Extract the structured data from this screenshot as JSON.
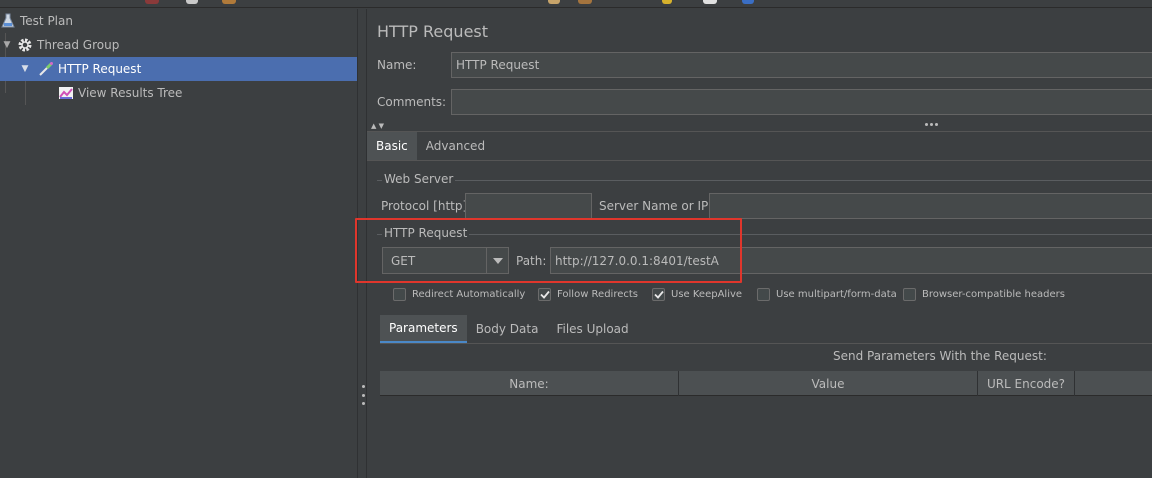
{
  "tree": {
    "items": [
      {
        "label": "Test Plan"
      },
      {
        "label": "Thread Group"
      },
      {
        "label": "HTTP Request"
      },
      {
        "label": "View Results Tree"
      }
    ]
  },
  "panel": {
    "title": "HTTP Request",
    "name_label": "Name:",
    "name_value": "HTTP Request",
    "comments_label": "Comments:",
    "comments_value": "",
    "tabs": [
      {
        "label": "Basic"
      },
      {
        "label": "Advanced"
      }
    ],
    "web_server": {
      "title": "Web Server",
      "protocol_label": "Protocol [http]:",
      "protocol_value": "",
      "server_label": "Server Name or IP:",
      "server_value": ""
    },
    "http_request": {
      "title": "HTTP Request",
      "method": "GET",
      "path_label": "Path:",
      "path_value": "http://127.0.0.1:8401/testA"
    },
    "checkboxes": [
      {
        "label": "Redirect Automatically",
        "checked": false
      },
      {
        "label": "Follow Redirects",
        "checked": true
      },
      {
        "label": "Use KeepAlive",
        "checked": true
      },
      {
        "label": "Use multipart/form-data",
        "checked": false
      },
      {
        "label": "Browser-compatible headers",
        "checked": false
      }
    ],
    "subtabs": [
      {
        "label": "Parameters"
      },
      {
        "label": "Body Data"
      },
      {
        "label": "Files Upload"
      }
    ],
    "send_label": "Send Parameters With the Request:",
    "table_headers": [
      {
        "label": "Name:"
      },
      {
        "label": "Value"
      },
      {
        "label": "URL Encode?"
      }
    ]
  },
  "colors": {
    "background": "#3c3f41",
    "selection": "#4b6eaf",
    "highlight_box": "#e0362c"
  }
}
